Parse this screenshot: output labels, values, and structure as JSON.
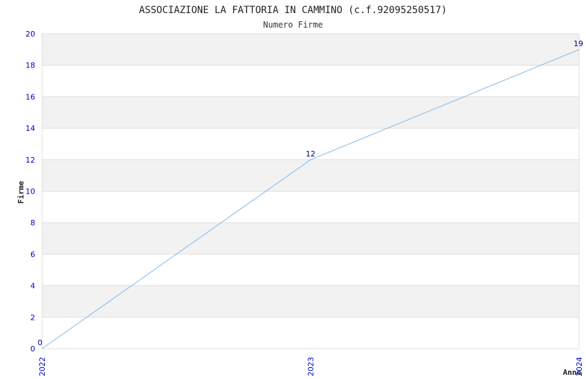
{
  "chart_data": {
    "type": "line",
    "title": "ASSOCIAZIONE LA FATTORIA IN CAMMINO (c.f.92095250517)",
    "subtitle": "Numero Firme",
    "xlabel": "Anno",
    "ylabel": "Firme",
    "categories": [
      "2022",
      "2023",
      "2024"
    ],
    "series": [
      {
        "values": [
          0,
          12,
          19
        ],
        "data_labels": [
          "0",
          "12",
          "19"
        ]
      }
    ],
    "ylim": [
      0,
      20
    ],
    "yticks": [
      0,
      2,
      4,
      6,
      8,
      10,
      12,
      14,
      16,
      18,
      20
    ],
    "grid": "horizontal bands",
    "colors": {
      "line": "#7db8ef",
      "band": "#f2f2f2",
      "grid": "#dddddd",
      "tick_text": "#0000cc",
      "data_label": "#000080"
    }
  }
}
